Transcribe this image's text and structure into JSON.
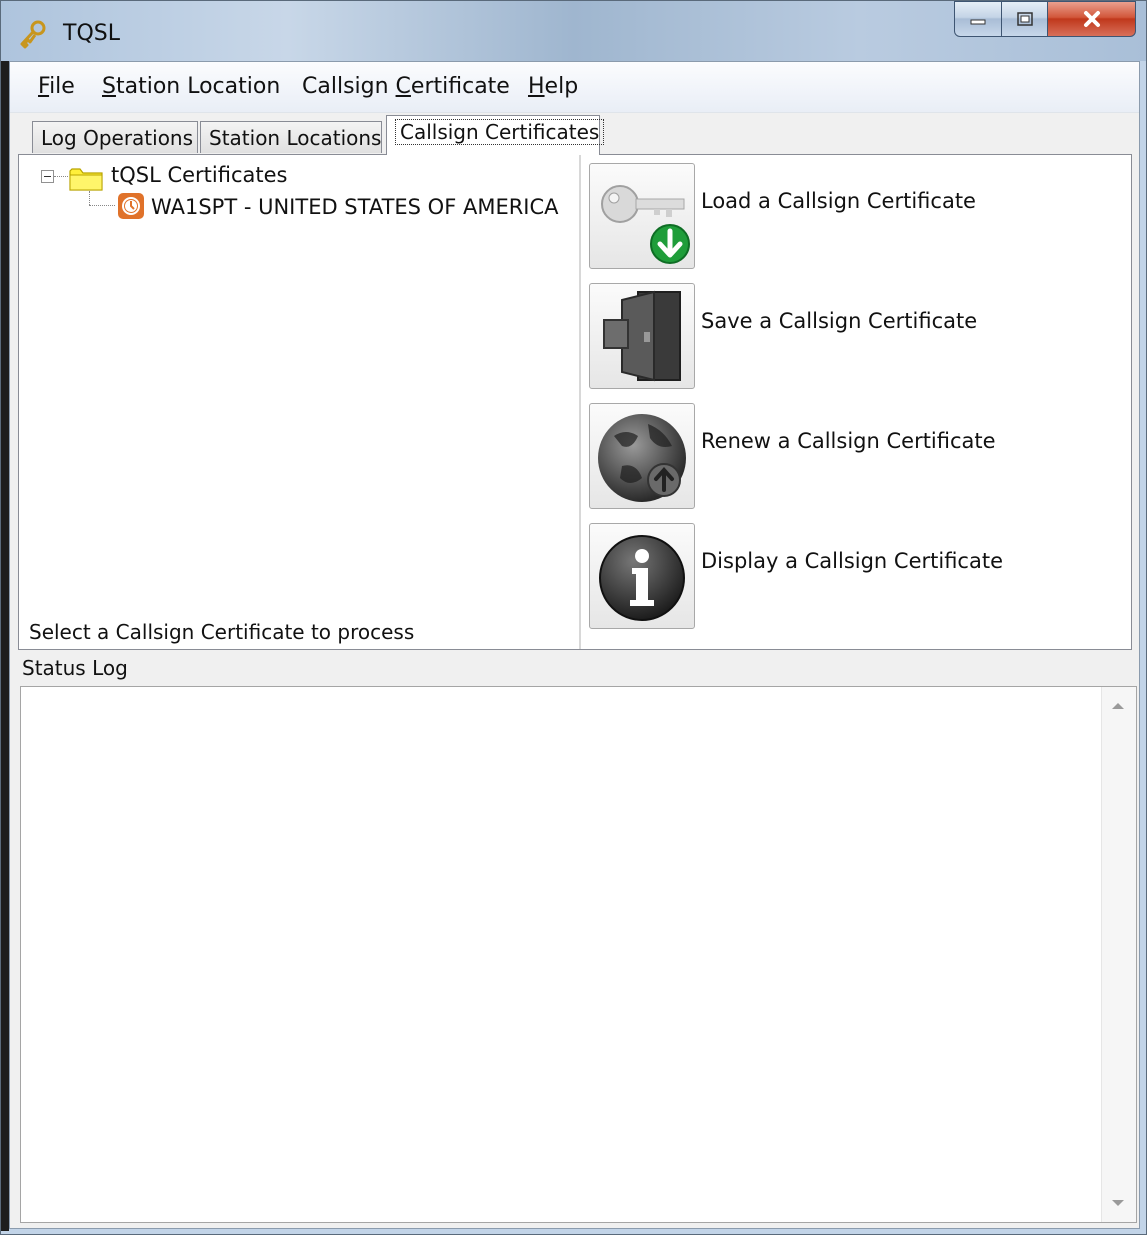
{
  "window": {
    "title": "TQSL"
  },
  "menu": [
    {
      "label": "File",
      "mnemonic": "F",
      "rest": "ile"
    },
    {
      "label": "Station Location",
      "mnemonic": "S",
      "rest": "tation Location"
    },
    {
      "label": "Callsign Certificate",
      "pre": "Callsign ",
      "mnemonic": "C",
      "rest": "ertificate"
    },
    {
      "label": "Help",
      "mnemonic": "H",
      "rest": "elp"
    }
  ],
  "tabs": [
    {
      "label": "Log Operations"
    },
    {
      "label": "Station Locations"
    },
    {
      "label": "Callsign Certificates"
    }
  ],
  "tree": {
    "root": "tQSL Certificates",
    "child": "WA1SPT - UNITED STATES OF AMERICA"
  },
  "hint": "Select a Callsign Certificate to process",
  "actions": [
    {
      "label": "Load a Callsign Certificate",
      "icon": "key-download-icon"
    },
    {
      "label": "Save a Callsign Certificate",
      "icon": "door-save-icon"
    },
    {
      "label": "Renew a Callsign Certificate",
      "icon": "globe-upload-icon"
    },
    {
      "label": "Display a Callsign Certificate",
      "icon": "info-icon"
    }
  ],
  "status_log": {
    "label": "Status Log",
    "content": ""
  },
  "colors": {
    "accent_green": "#1f9d3a",
    "cert_orange": "#e0722a",
    "folder_yellow": "#ffef3a",
    "close_red": "#c7432a"
  }
}
